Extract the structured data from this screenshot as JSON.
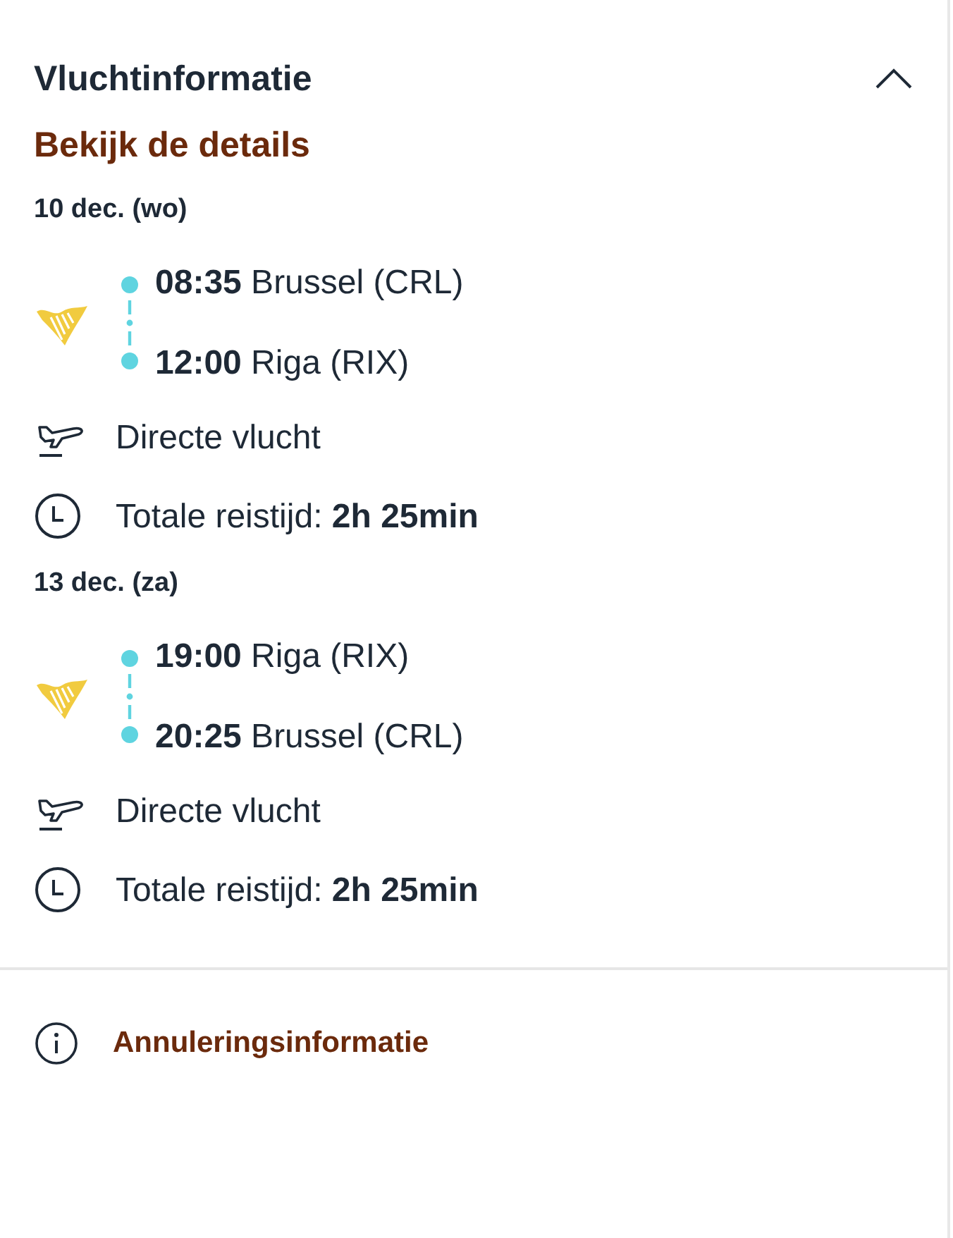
{
  "section": {
    "title": "Vluchtinformatie",
    "expanded": true
  },
  "details_link": "Bekijk de details",
  "flights": [
    {
      "date": "10 dec. (wo)",
      "segments": [
        "**08:35** Brussel (CRL)",
        "**12:00** Riga (RIX)"
      ],
      "stop_info": "Directe vlucht",
      "duration": "Totale reistijd: **2h 25min**"
    },
    {
      "date": "13 dec. (za)",
      "segments": [
        "**19:00** Riga (RIX)",
        "**20:25** Brussel (CRL)"
      ],
      "stop_info": "Directe vlucht",
      "duration": "Totale reistijd: **2h 25min**"
    }
  ],
  "footer_link": "Annuleringsinformatie"
}
